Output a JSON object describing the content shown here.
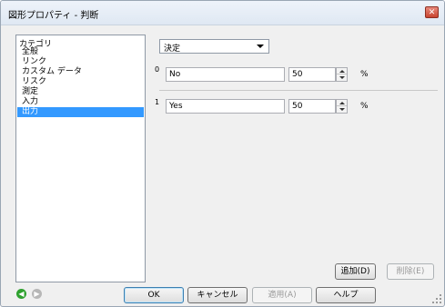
{
  "window": {
    "title": "図形プロパティ - 判断",
    "close_icon": "✕"
  },
  "category": {
    "header": "カテゴリ",
    "items": [
      {
        "label": "全般",
        "selected": false
      },
      {
        "label": "リンク",
        "selected": false
      },
      {
        "label": "カスタム データ",
        "selected": false
      },
      {
        "label": "リスク",
        "selected": false
      },
      {
        "label": "測定",
        "selected": false
      },
      {
        "label": "入力",
        "selected": false
      },
      {
        "label": "出力",
        "selected": true
      }
    ]
  },
  "output_panel": {
    "dropdown_value": "決定",
    "rows": [
      {
        "index": "0",
        "name": "No",
        "value": "50",
        "unit": "%"
      },
      {
        "index": "1",
        "name": "Yes",
        "value": "50",
        "unit": "%"
      }
    ],
    "add_button": "追加(D)",
    "delete_button": "削除(E)"
  },
  "footer": {
    "ok": "OK",
    "cancel": "キャンセル",
    "apply": "適用(A)",
    "help": "ヘルプ"
  },
  "icons": {
    "back": "◀",
    "forward": "▶"
  }
}
